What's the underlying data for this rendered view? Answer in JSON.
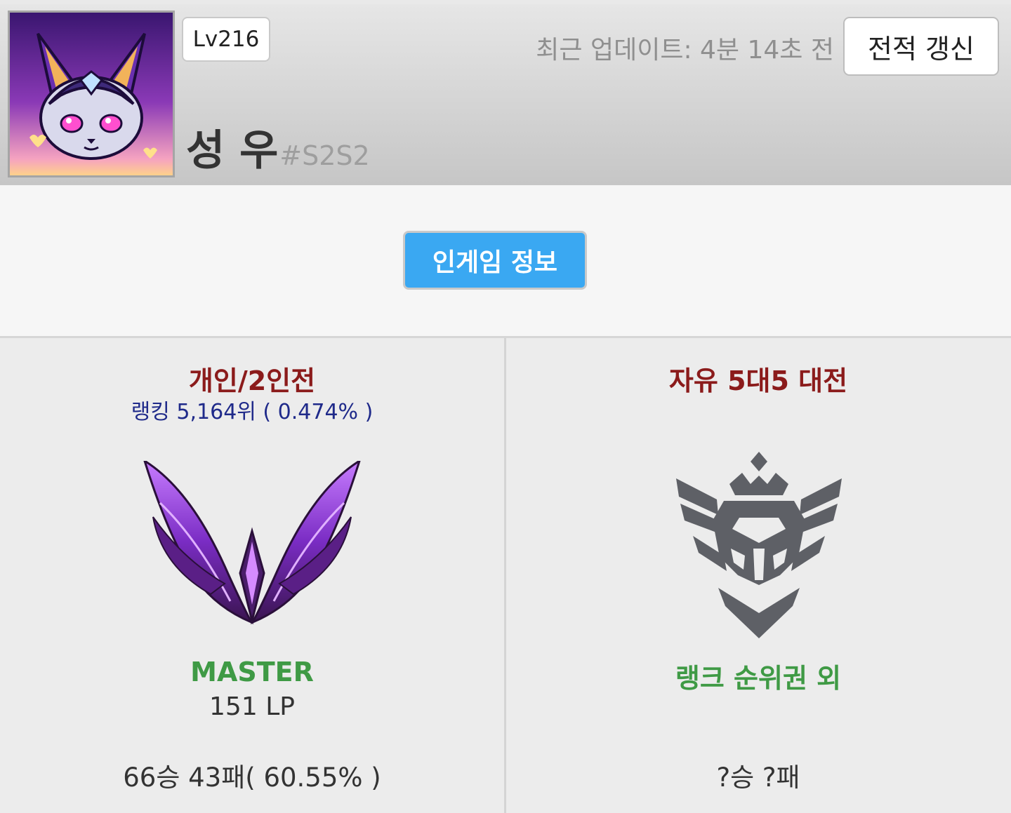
{
  "profile": {
    "level": "Lv216",
    "name": "성 우",
    "tag": "#S2S2",
    "last_update": "최근 업데이트: 4분 14초 전",
    "refresh_label": "전적 갱신",
    "avatar_icon": "bunny-mask-profile-icon"
  },
  "ingame": {
    "button_label": "인게임 정보"
  },
  "ranks": {
    "solo": {
      "title": "개인/2인전",
      "ranking": "랭킹 5,164위 ( 0.474% )",
      "emblem_icon": "master-emblem-icon",
      "tier": "MASTER",
      "lp": "151 LP",
      "record": "66승 43패( 60.55% )"
    },
    "flex": {
      "title": "자유 5대5 대전",
      "emblem_icon": "unranked-emblem-icon",
      "tier": "랭크 순위권 외",
      "record": "?승 ?패"
    }
  },
  "colors": {
    "queue_title": "#8b1b1b",
    "ranking": "#1f2a8a",
    "tier": "#3f9a45",
    "ingame_button": "#3aa8f2"
  }
}
